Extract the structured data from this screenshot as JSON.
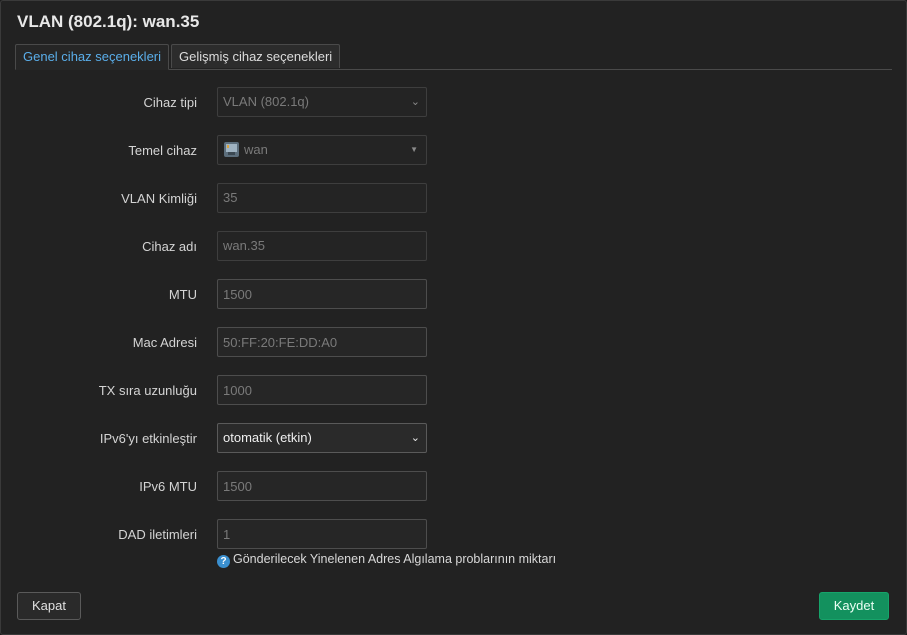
{
  "dialog": {
    "title": "VLAN (802.1q): wan.35"
  },
  "tabs": [
    {
      "label": "Genel cihaz seçenekleri",
      "active": true
    },
    {
      "label": "Gelişmiş cihaz seçenekleri",
      "active": false
    }
  ],
  "form": {
    "device_type": {
      "label": "Cihaz tipi",
      "value": "VLAN (802.1q)"
    },
    "base_device": {
      "label": "Temel cihaz",
      "value": "wan",
      "icon": "ethernet-port-icon"
    },
    "vlan_id": {
      "label": "VLAN Kimliği",
      "value": "35"
    },
    "device_name": {
      "label": "Cihaz adı",
      "value": "wan.35"
    },
    "mtu": {
      "label": "MTU",
      "placeholder": "1500"
    },
    "mac_address": {
      "label": "Mac Adresi",
      "placeholder": "50:FF:20:FE:DD:A0"
    },
    "tx_queue_length": {
      "label": "TX sıra uzunluğu",
      "placeholder": "1000"
    },
    "ipv6_enable": {
      "label": "IPv6'yı etkinleştir",
      "value": "otomatik (etkin)"
    },
    "ipv6_mtu": {
      "label": "IPv6 MTU",
      "placeholder": "1500"
    },
    "dad_transmits": {
      "label": "DAD iletimleri",
      "placeholder": "1",
      "hint": "Gönderilecek Yinelenen Adres Algılama problarının miktarı"
    }
  },
  "buttons": {
    "close": "Kapat",
    "save": "Kaydet"
  },
  "colors": {
    "accent_tab": "#5aaeea",
    "save_button": "#13915e",
    "hint_icon": "#3a8fcf"
  }
}
